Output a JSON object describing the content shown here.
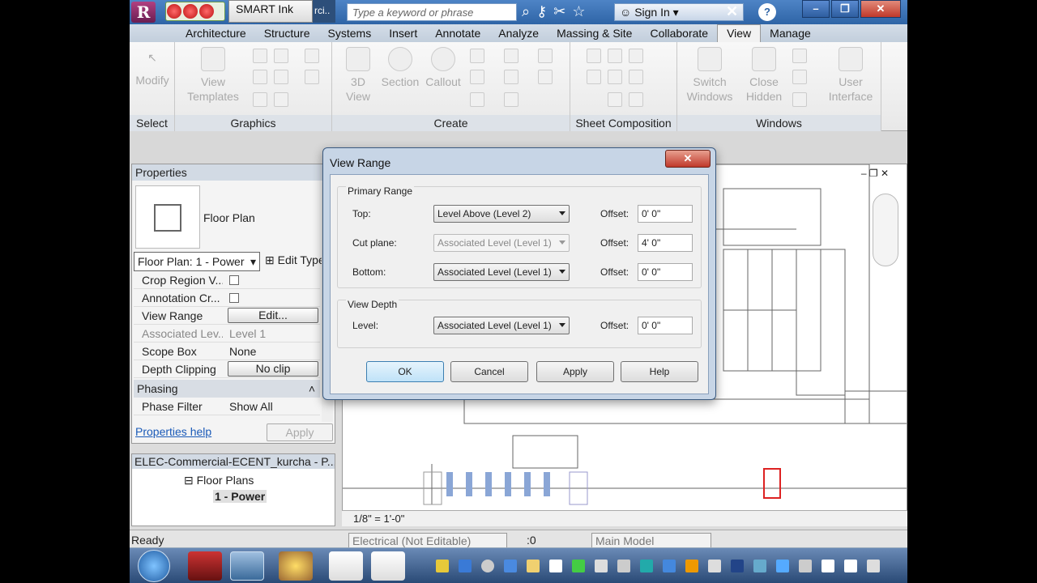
{
  "titlebar": {
    "app_logo": "R",
    "smart_ink": "SMART Ink",
    "file_tab_fragment": "rci..",
    "search_placeholder": "Type a keyword or phrase",
    "sign_in": "Sign In",
    "icons": [
      "binoculars-icon",
      "key-icon",
      "satellite-icon",
      "star-icon",
      "user-icon"
    ]
  },
  "ribbon_tabs": [
    "Architecture",
    "Structure",
    "Systems",
    "Insert",
    "Annotate",
    "Analyze",
    "Massing & Site",
    "Collaborate",
    "View",
    "Manage"
  ],
  "ribbon_active_tab": "View",
  "ribbon_panels": {
    "select": {
      "title": "Select",
      "modify": "Modify"
    },
    "graphics": {
      "title": "Graphics",
      "view_templates_1": "View",
      "view_templates_2": "Templates"
    },
    "create": {
      "title": "Create",
      "view3d_1": "3D",
      "view3d_2": "View",
      "section": "Section",
      "callout": "Callout"
    },
    "sheet": {
      "title": "Sheet Composition"
    },
    "windows": {
      "title": "Windows",
      "switch_1": "Switch",
      "switch_2": "Windows",
      "close_1": "Close",
      "close_2": "Hidden",
      "ui_1": "User",
      "ui_2": "Interface"
    }
  },
  "properties": {
    "title": "Properties",
    "type_name": "Floor Plan",
    "instance": "Floor Plan: 1 - Power",
    "edit_type": "Edit Type",
    "rows": [
      {
        "name": "Crop Region V...",
        "value": ""
      },
      {
        "name": "Annotation Cr...",
        "value": ""
      },
      {
        "name": "View Range",
        "value": "Edit..."
      },
      {
        "name": "Associated Lev...",
        "value": "Level 1"
      },
      {
        "name": "Scope Box",
        "value": "None"
      },
      {
        "name": "Depth Clipping",
        "value": "No clip"
      }
    ],
    "phasing_header": "Phasing",
    "phase_filter_name": "Phase Filter",
    "phase_filter_value": "Show All",
    "help": "Properties help",
    "apply": "Apply"
  },
  "browser": {
    "title": "ELEC-Commercial-ECENT_kurcha - P...",
    "floor_plans": "Floor Plans",
    "current": "1 - Power"
  },
  "view_control": {
    "scale": "1/8\" = 1'-0\""
  },
  "status": {
    "ready": "Ready",
    "workset": "Electrical (Not Editable)",
    "count": ":0",
    "model": "Main Model"
  },
  "dialog": {
    "title": "View Range",
    "primary_range": "Primary Range",
    "top_label": "Top:",
    "top_value": "Level Above (Level 2)",
    "top_offset": "0'  0\"",
    "cut_label": "Cut plane:",
    "cut_value": "Associated Level (Level 1)",
    "cut_offset": "4'  0\"",
    "bottom_label": "Bottom:",
    "bottom_value": "Associated Level (Level 1)",
    "bottom_offset": "0'  0\"",
    "view_depth": "View Depth",
    "level_label": "Level:",
    "level_value": "Associated Level (Level 1)",
    "level_offset": "0'  0\"",
    "offset_label": "Offset:",
    "ok": "OK",
    "cancel": "Cancel",
    "apply": "Apply",
    "help": "Help"
  }
}
